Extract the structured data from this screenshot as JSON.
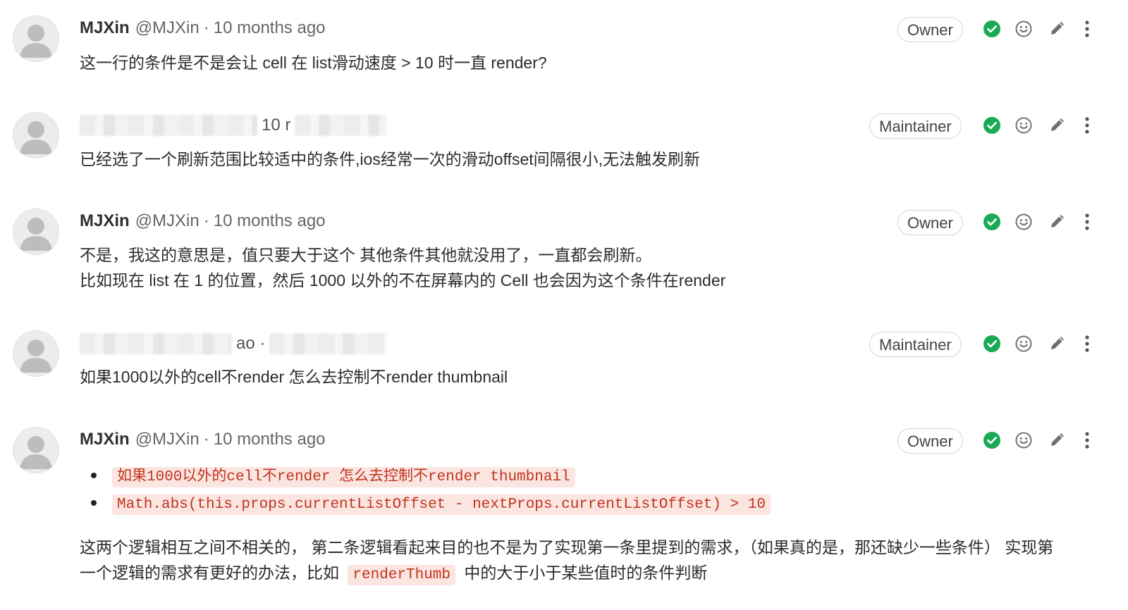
{
  "notes": [
    {
      "author": "MJXin",
      "handle": "@MJXin",
      "separator": "·",
      "time": "10 months ago",
      "role": "Owner",
      "body": [
        "这一行的条件是不是会让 cell 在 list滑动速度 > 10 时一直 render?"
      ]
    },
    {
      "redacted_fragment": "10 r",
      "role": "Maintainer",
      "body": [
        "已经选了一个刷新范围比较适中的条件,ios经常一次的滑动offset间隔很小,无法触发刷新"
      ]
    },
    {
      "author": "MJXin",
      "handle": "@MJXin",
      "separator": "·",
      "time": "10 months ago",
      "role": "Owner",
      "body": [
        "不是，我这的意思是，值只要大于这个 其他条件其他就没用了，一直都会刷新。",
        "比如现在 list 在 1 的位置，然后 1000 以外的不在屏幕内的 Cell 也会因为这个条件在render"
      ]
    },
    {
      "redacted_fragment": "ao ·",
      "role": "Maintainer",
      "body": [
        "如果1000以外的cell不render 怎么去控制不render thumbnail"
      ]
    },
    {
      "author": "MJXin",
      "handle": "@MJXin",
      "separator": "·",
      "time": "10 months ago",
      "role": "Owner",
      "bullets": [
        "如果1000以外的cell不render 怎么去控制不render thumbnail",
        "Math.abs(this.props.currentListOffset - nextProps.currentListOffset) > 10"
      ],
      "paragraph_line1": "这两个逻辑相互之间不相关的， 第二条逻辑看起来目的也不是为了实现第一条里提到的需求，（如果真的是，那还缺少一些条件） 实现第",
      "paragraph_line2_before": "一个逻辑的需求有更好的办法，比如",
      "paragraph_code": "renderThumb",
      "paragraph_line2_after": "中的大于小于某些值时的条件判断"
    }
  ],
  "icons": [
    "resolve-thread-icon",
    "add-reaction-icon",
    "edit-icon",
    "more-actions-icon"
  ],
  "colors": {
    "resolve_green": "#1aaa55",
    "code_text": "#c0341d",
    "code_bg": "#fbe5e1",
    "muted": "#666666"
  }
}
